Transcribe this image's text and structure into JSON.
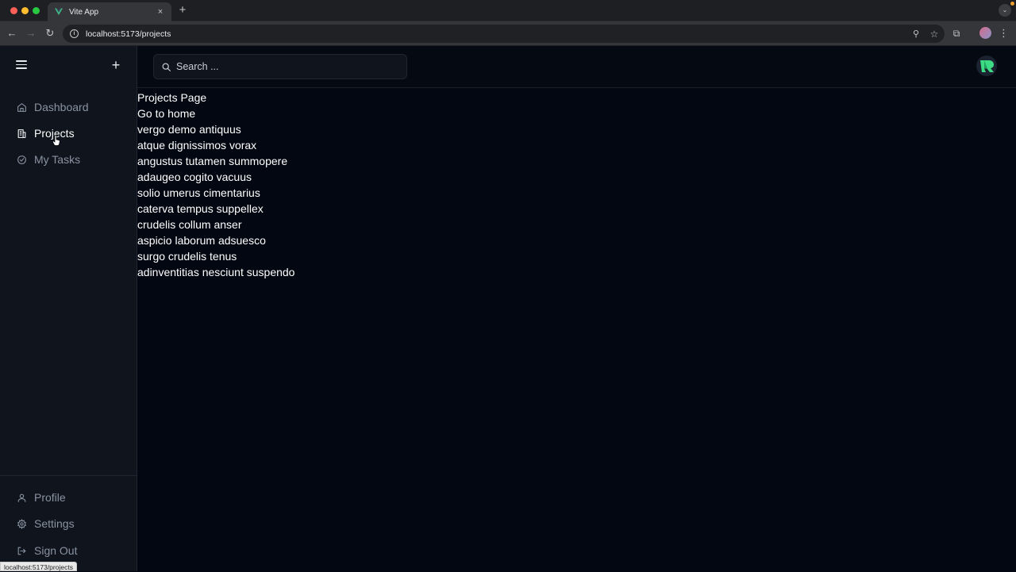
{
  "browser": {
    "tab_title": "Vite App",
    "tab_close": "×",
    "new_tab": "+",
    "url": "localhost:5173/projects",
    "status_url": "localhost:5173/projects"
  },
  "sidebar": {
    "new_button": "+",
    "nav": [
      {
        "label": "Dashboard",
        "icon": "home-icon"
      },
      {
        "label": "Projects",
        "icon": "building-icon",
        "active": true
      },
      {
        "label": "My Tasks",
        "icon": "check-circle-icon"
      }
    ],
    "bottom": [
      {
        "label": "Profile",
        "icon": "user-icon"
      },
      {
        "label": "Settings",
        "icon": "gear-icon"
      },
      {
        "label": "Sign Out",
        "icon": "logout-icon"
      }
    ]
  },
  "header": {
    "search_placeholder": "Search ..."
  },
  "content": {
    "page_title": "Projects Page",
    "home_link": "Go to home",
    "projects": [
      "vergo demo antiquus",
      "atque dignissimos vorax",
      "angustus tutamen summopere",
      "adaugeo cogito vacuus",
      "solio umerus cimentarius",
      "caterva tempus suppellex",
      "crudelis collum anser",
      "aspicio laborum adsuesco",
      "surgo crudelis tenus",
      "adinventitias nesciunt suspendo"
    ]
  },
  "colors": {
    "background": "#030711",
    "sidebar": "#0f141d",
    "accent_logo": "#3ddc84"
  }
}
